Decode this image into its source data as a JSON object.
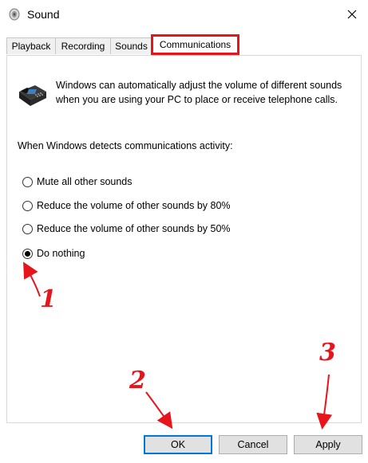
{
  "window": {
    "title": "Sound",
    "icon": "speaker-icon",
    "close_icon": "close-icon"
  },
  "tabs": [
    {
      "label": "Playback",
      "active": false
    },
    {
      "label": "Recording",
      "active": false
    },
    {
      "label": "Sounds",
      "active": false
    },
    {
      "label": "Communications",
      "active": true
    }
  ],
  "communications": {
    "icon": "telephone-icon",
    "description": "Windows can automatically adjust the volume of different sounds when you are using your PC to place or receive telephone calls.",
    "detects_label": "When Windows detects communications activity:",
    "options": [
      {
        "label": "Mute all other sounds",
        "checked": false
      },
      {
        "label": "Reduce the volume of other sounds by 80%",
        "checked": false
      },
      {
        "label": "Reduce the volume of other sounds by 50%",
        "checked": false
      },
      {
        "label": "Do nothing",
        "checked": true
      }
    ]
  },
  "buttons": {
    "ok": "OK",
    "cancel": "Cancel",
    "apply": "Apply"
  },
  "annotations": {
    "marker_1": "1",
    "marker_2": "2",
    "marker_3": "3",
    "color": "#e8141c"
  },
  "colors": {
    "tab_highlight": "#e8141c",
    "default_button_border": "#0078d7"
  }
}
